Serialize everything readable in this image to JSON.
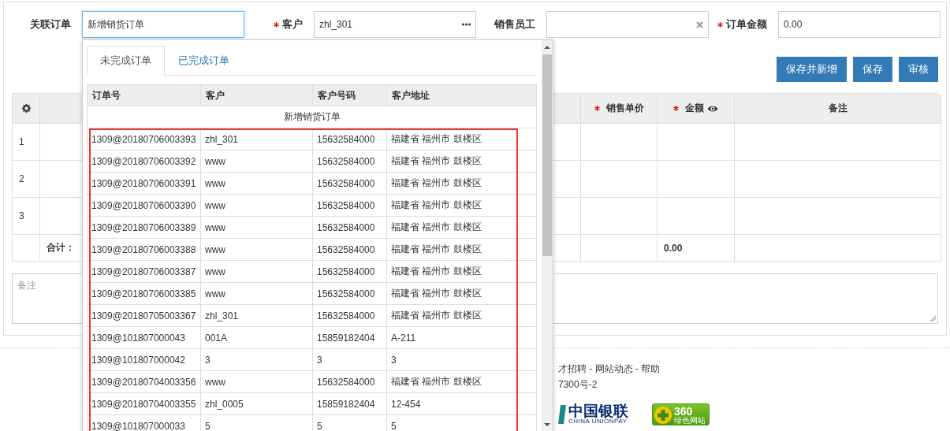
{
  "form": {
    "fields": [
      {
        "label": "关联订单",
        "required": false,
        "value": "新增销货订单",
        "kind": "text",
        "focused": true
      },
      {
        "label": "客户",
        "required": true,
        "value": "zhl_301",
        "kind": "picker",
        "focused": false
      },
      {
        "label": "销售员工",
        "required": false,
        "kind": "clearable",
        "focused": false
      },
      {
        "label": "订单金额",
        "required": true,
        "value": "0.00",
        "kind": "text",
        "focused": false
      }
    ]
  },
  "buttons": [
    "保存并新增",
    "保存",
    "审核"
  ],
  "grid": {
    "columns": [
      {
        "kind": "gear",
        "required": false
      },
      {
        "kind": "plain",
        "required": false
      },
      {
        "label": "销售单价",
        "kind": "plain",
        "required": true
      },
      {
        "label": "金额",
        "kind": "eye",
        "required": true
      },
      {
        "label": "备注",
        "kind": "plain",
        "required": false
      }
    ],
    "row_numbers": [
      "1",
      "2",
      "3"
    ],
    "total_label": "合计：",
    "total_amount": "0.00"
  },
  "notes": {
    "placeholder": "备注"
  },
  "footer": {
    "links": "才招聘 - 网站动态 - 帮助",
    "license": "7300号-2",
    "unionpay": {
      "name": "中国银联",
      "english": "CHINA UNIONPAY"
    },
    "badge": {
      "number": "360",
      "caption": "绿色网站"
    }
  },
  "dropdown": {
    "tabs": [
      {
        "label": "未完成订单",
        "selected": true
      },
      {
        "label": "已完成订单",
        "selected": false
      }
    ],
    "columns": [
      "订单号",
      "客户",
      "客户号码",
      "客户地址"
    ],
    "new_row": "新增销货订单",
    "highlight_frame": true,
    "rows": [
      {
        "order_no": "1309@20180706003393",
        "customer": "zhl_301",
        "phone": "15632584000",
        "address": "福建省 福州市 鼓楼区"
      },
      {
        "order_no": "1309@20180706003392",
        "customer": "www",
        "phone": "15632584000",
        "address": "福建省 福州市 鼓楼区"
      },
      {
        "order_no": "1309@20180706003391",
        "customer": "www",
        "phone": "15632584000",
        "address": "福建省 福州市 鼓楼区"
      },
      {
        "order_no": "1309@20180706003390",
        "customer": "www",
        "phone": "15632584000",
        "address": "福建省 福州市 鼓楼区"
      },
      {
        "order_no": "1309@20180706003389",
        "customer": "www",
        "phone": "15632584000",
        "address": "福建省 福州市 鼓楼区"
      },
      {
        "order_no": "1309@20180706003388",
        "customer": "www",
        "phone": "15632584000",
        "address": "福建省 福州市 鼓楼区"
      },
      {
        "order_no": "1309@20180706003387",
        "customer": "www",
        "phone": "15632584000",
        "address": "福建省 福州市 鼓楼区"
      },
      {
        "order_no": "1309@20180706003385",
        "customer": "www",
        "phone": "15632584000",
        "address": "福建省 福州市 鼓楼区"
      },
      {
        "order_no": "1309@20180705003367",
        "customer": "zhl_301",
        "phone": "15632584000",
        "address": "福建省 福州市 鼓楼区"
      },
      {
        "order_no": "1309@101807000043",
        "customer": "001A",
        "phone": "15859182404",
        "address": "A-211"
      },
      {
        "order_no": "1309@101807000042",
        "customer": "3",
        "phone": "3",
        "address": "3"
      },
      {
        "order_no": "1309@20180704003356",
        "customer": "www",
        "phone": "15632584000",
        "address": "福建省 福州市 鼓楼区"
      },
      {
        "order_no": "1309@20180704003355",
        "customer": "zhl_0005",
        "phone": "15859182404",
        "address": "12-454"
      },
      {
        "order_no": "1309@101807000033",
        "customer": "5",
        "phone": "5",
        "address": "5"
      }
    ]
  }
}
